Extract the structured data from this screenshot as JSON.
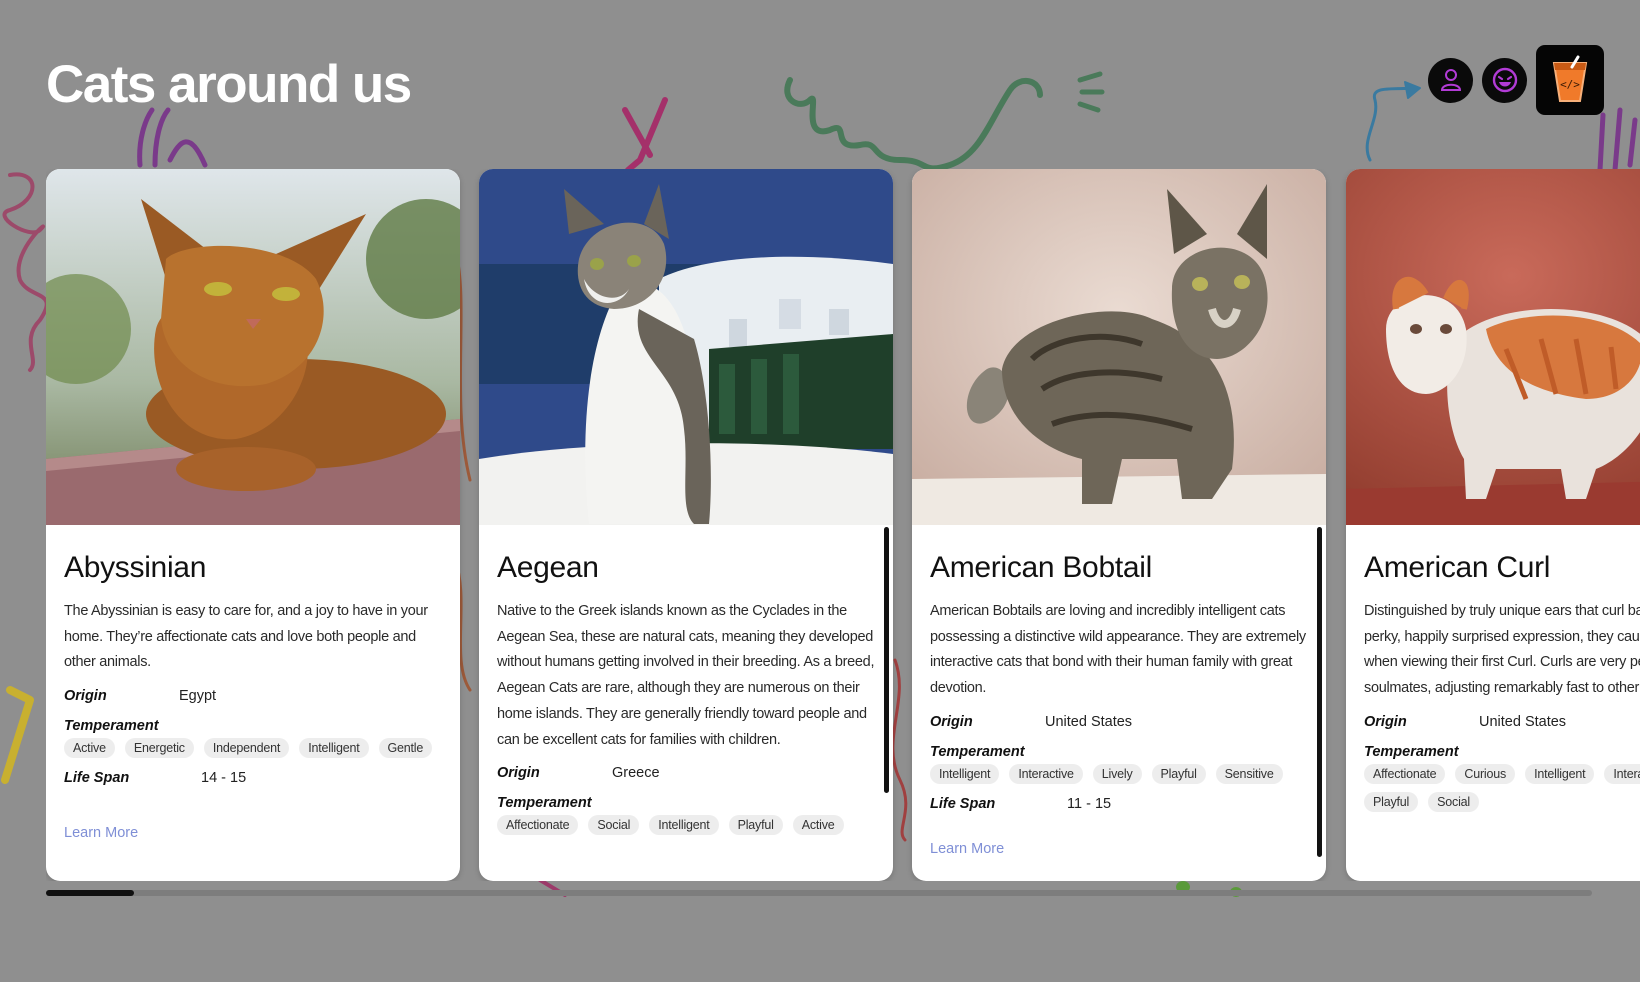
{
  "page": {
    "title": "Cats around us",
    "background": "#8f8f8f"
  },
  "header_icons": [
    {
      "name": "user-icon",
      "color": "#b23bd6"
    },
    {
      "name": "smiley-icon",
      "color": "#b23bd6"
    },
    {
      "name": "code-drink-cup-icon",
      "color": "#f07a2a"
    }
  ],
  "cards": [
    {
      "name": "Abyssinian",
      "description": "The Abyssinian is easy to care for, and a joy to have in your home. They’re affectionate cats and love both people and other animals.",
      "origin_label": "Origin",
      "origin": "Egypt",
      "temperament_label": "Temperament",
      "temperament": [
        "Active",
        "Energetic",
        "Independent",
        "Intelligent",
        "Gentle"
      ],
      "lifespan_label": "Life Span",
      "lifespan": "14 - 15",
      "learn_more": "Learn More",
      "photo": "orange-brown ticked cat lying on a stone ledge"
    },
    {
      "name": "Aegean",
      "description": "Native to the Greek islands known as the Cyclades in the Aegean Sea, these are natural cats, meaning they developed without humans getting involved in their breeding. As a breed, Aegean Cats are rare, although they are numerous on their home islands. They are generally friendly toward people and can be excellent cats for families with children.",
      "origin_label": "Origin",
      "origin": "Greece",
      "temperament_label": "Temperament",
      "temperament": [
        "Affectionate",
        "Social",
        "Intelligent",
        "Playful",
        "Active"
      ],
      "photo": "tabby and white cat sitting with whitewashed island town behind"
    },
    {
      "name": "American Bobtail",
      "description": "American Bobtails are loving and incredibly intelligent cats possessing a distinctive wild appearance. They are extremely interactive cats that bond with their human family with great devotion.",
      "origin_label": "Origin",
      "origin": "United States",
      "temperament_label": "Temperament",
      "temperament": [
        "Intelligent",
        "Interactive",
        "Lively",
        "Playful",
        "Sensitive"
      ],
      "lifespan_label": "Life Span",
      "lifespan": "11 - 15",
      "learn_more": "Learn More",
      "photo": "grey brown tabby bobtail cat standing against beige wall"
    },
    {
      "name": "American Curl",
      "description": "Distinguished by truly unique ears that curl back in a graceful arc, offering an alert, perky, happily surprised expression, they cause people to break out into a smile when viewing their first Curl. Curls are very people-oriented, faithful, affectionate soulmates, adjusting remarkably fast to other pets, children, and new situations.",
      "origin_label": "Origin",
      "origin": "United States",
      "temperament_label": "Temperament",
      "temperament": [
        "Affectionate",
        "Curious",
        "Intelligent",
        "Interactive",
        "Playful",
        "Social"
      ],
      "photo": "orange and white curl-eared cat on red background"
    }
  ]
}
